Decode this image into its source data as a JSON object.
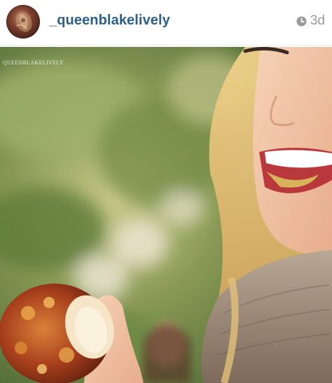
{
  "post": {
    "username": "_queenblakelively",
    "timestamp": "3d",
    "watermark": "QUEENBLAKELIVELY"
  },
  "icons": {
    "clock": "clock-icon",
    "avatar": "avatar-photo"
  },
  "colors": {
    "username": "#2c5f8a",
    "timestamp": "#9a9a9a"
  }
}
